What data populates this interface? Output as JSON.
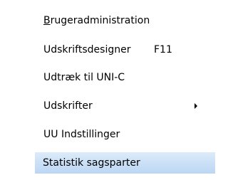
{
  "menu": {
    "items": [
      {
        "mnemonic": "B",
        "label_rest": "rugeradministration",
        "shortcut": "",
        "submenu": false,
        "highlighted": false
      },
      {
        "label": "Udskriftsdesigner",
        "shortcut": "F11",
        "submenu": false,
        "highlighted": false
      },
      {
        "label": "Udtræk til UNI-C",
        "shortcut": "",
        "submenu": false,
        "highlighted": false
      },
      {
        "label": "Udskrifter",
        "shortcut": "",
        "submenu": true,
        "highlighted": false
      },
      {
        "label": "UU Indstillinger",
        "shortcut": "",
        "submenu": false,
        "highlighted": false
      },
      {
        "label": "Statistik sagsparter",
        "shortcut": "",
        "submenu": false,
        "highlighted": true
      }
    ],
    "highlight_color": "#c9dff6"
  }
}
